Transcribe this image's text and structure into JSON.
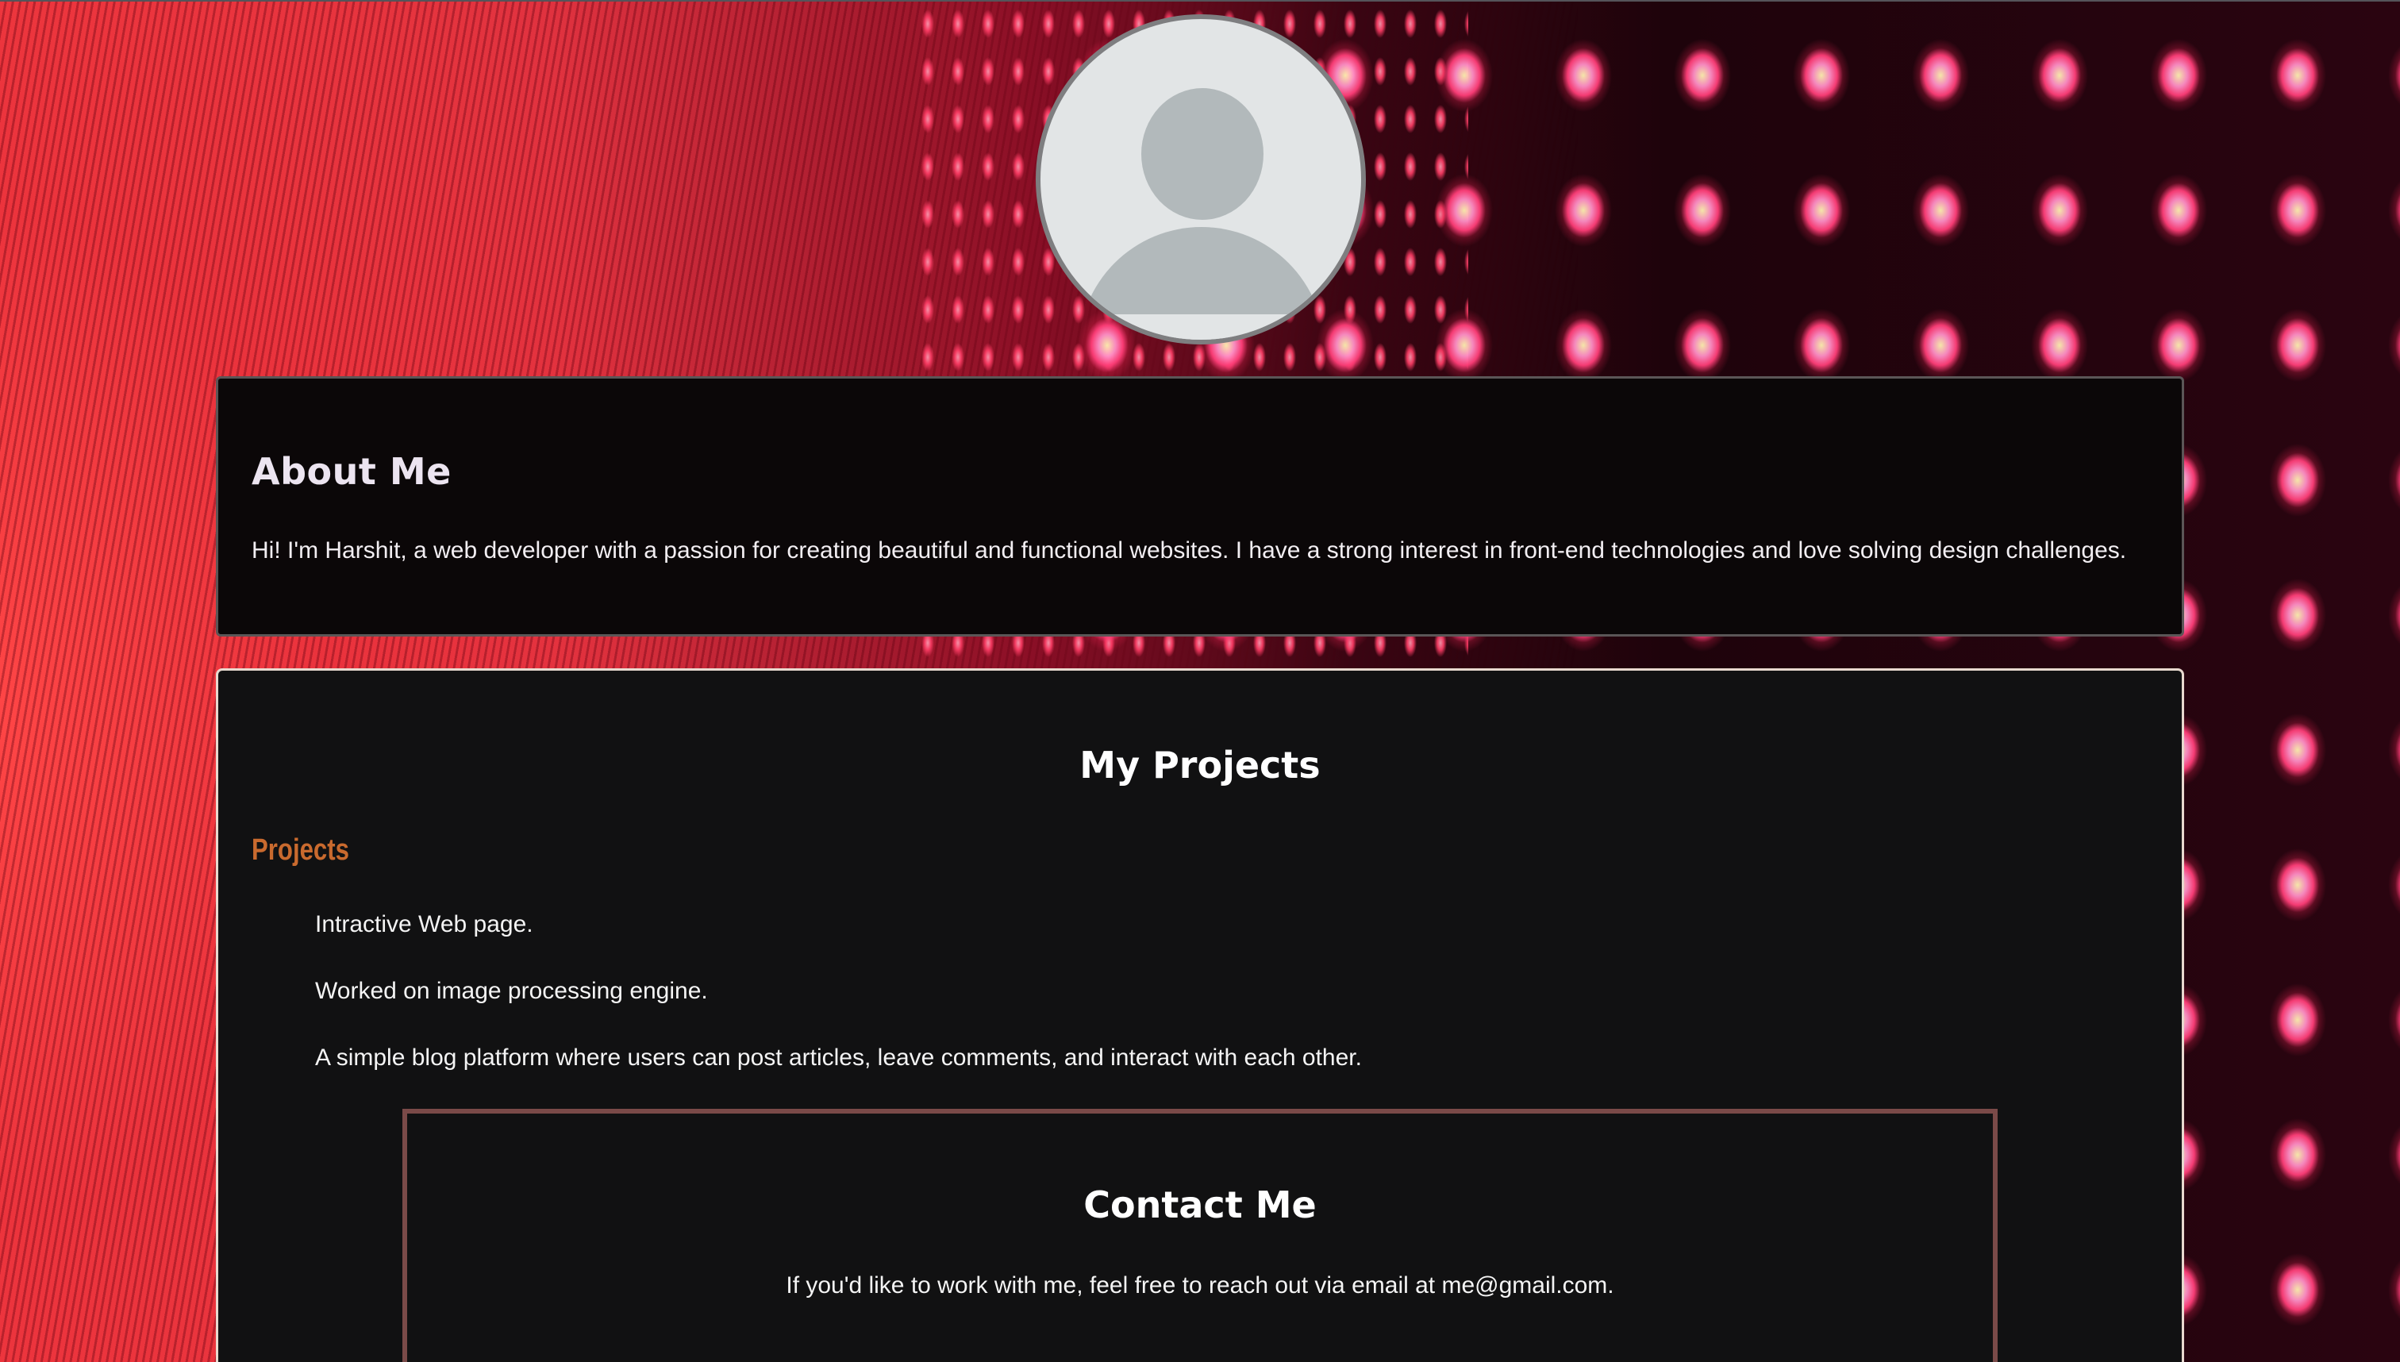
{
  "about": {
    "title": "About Me",
    "text": "Hi! I'm Harshit, a web developer with a passion for creating beautiful and functional websites. I have a strong interest in front-end technologies and love solving design challenges."
  },
  "projects": {
    "title": "My Projects",
    "subtitle": "Projects",
    "items": [
      "Intractive Web page.",
      "Worked on image processing engine.",
      "A simple blog platform where users can post articles, leave comments, and interact with each other."
    ]
  },
  "contact": {
    "title": "Contact Me",
    "text": "If you'd like to work with me, feel free to reach out via email at me@gmail.com."
  },
  "colors": {
    "projects_subtitle": "#c96a2e",
    "contact_border": "#7a4a48",
    "card_background": "#111112"
  },
  "icons": {
    "avatar": "default-user-avatar-icon"
  }
}
